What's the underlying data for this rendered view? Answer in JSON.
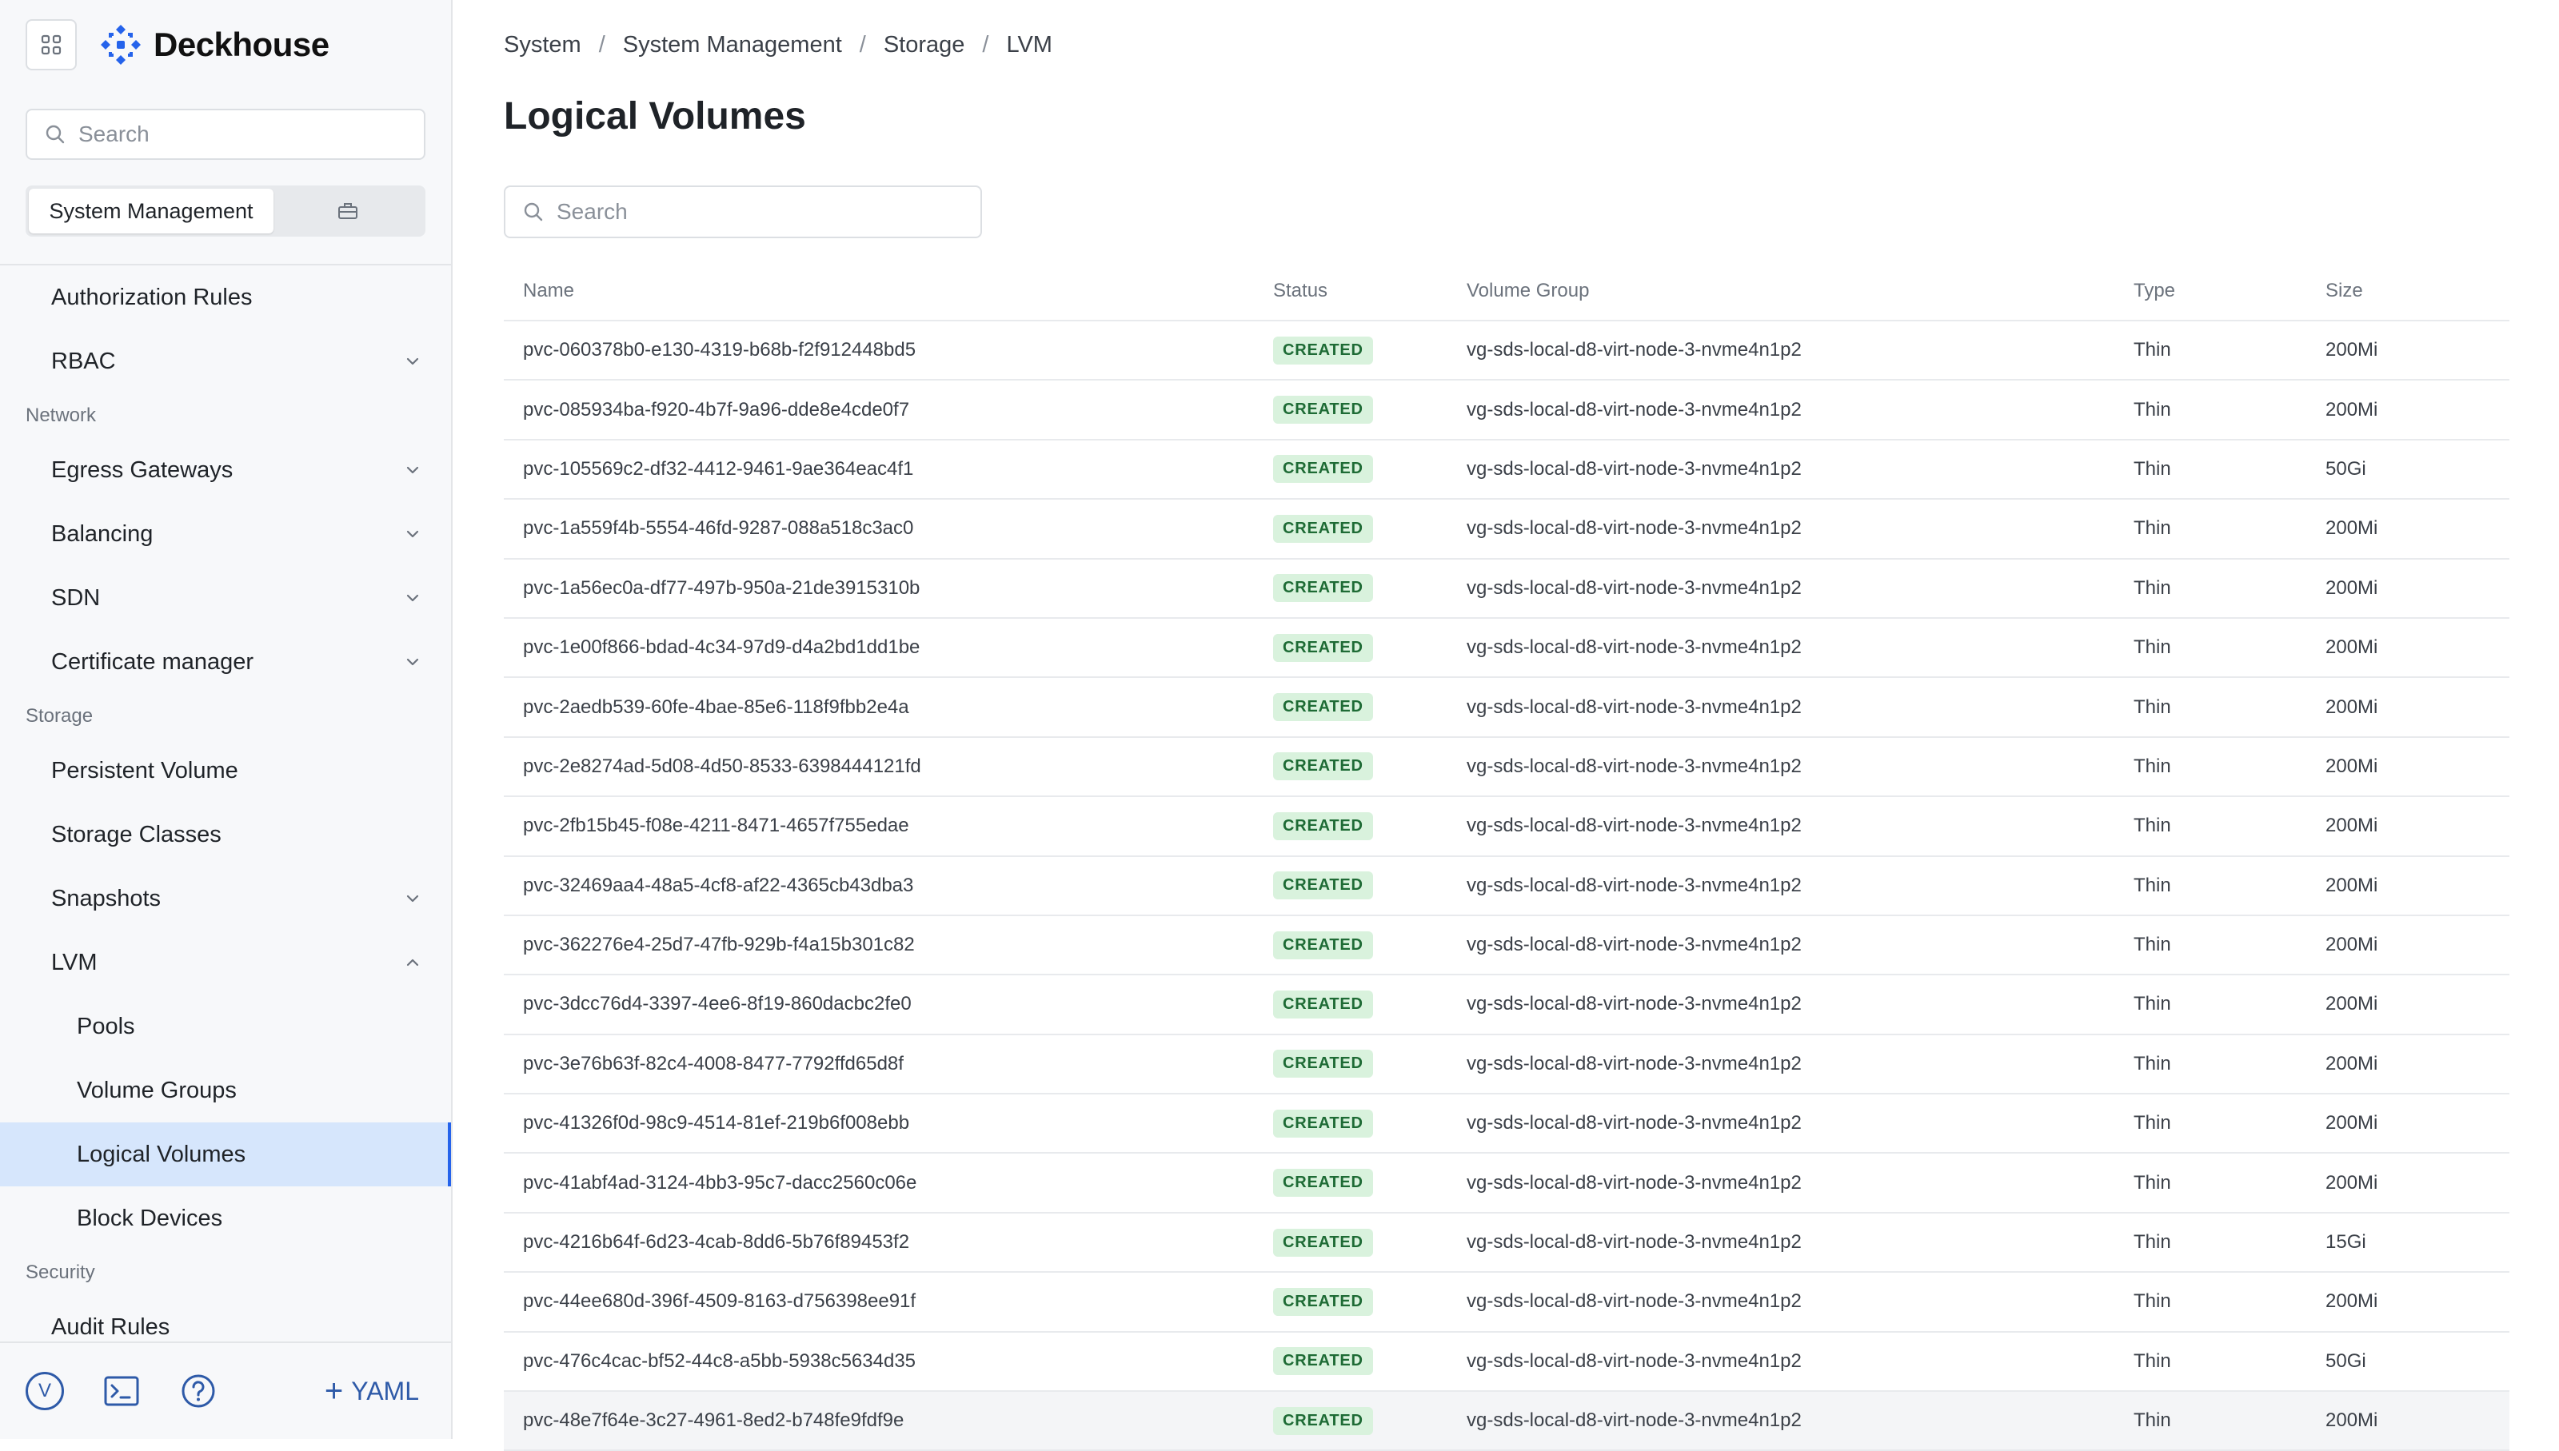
{
  "brand": {
    "name": "Deckhouse",
    "accent": "#2563eb",
    "logo_icon": "deckhouse-logo-icon"
  },
  "sidebar": {
    "search_placeholder": "Search",
    "scope_active": "System Management",
    "scope_alt_icon": "briefcase-icon",
    "nav": [
      {
        "type": "item",
        "label": "Authorization Rules",
        "chevron": ""
      },
      {
        "type": "item",
        "label": "RBAC",
        "chevron": "down"
      },
      {
        "type": "section",
        "label": "Network"
      },
      {
        "type": "item",
        "label": "Egress Gateways",
        "chevron": "down"
      },
      {
        "type": "item",
        "label": "Balancing",
        "chevron": "down"
      },
      {
        "type": "item",
        "label": "SDN",
        "chevron": "down"
      },
      {
        "type": "item",
        "label": "Certificate manager",
        "chevron": "down"
      },
      {
        "type": "section",
        "label": "Storage"
      },
      {
        "type": "item",
        "label": "Persistent Volume",
        "chevron": ""
      },
      {
        "type": "item",
        "label": "Storage Classes",
        "chevron": ""
      },
      {
        "type": "item",
        "label": "Snapshots",
        "chevron": "down"
      },
      {
        "type": "item",
        "label": "LVM",
        "chevron": "up"
      },
      {
        "type": "sub",
        "label": "Pools",
        "chevron": ""
      },
      {
        "type": "sub",
        "label": "Volume Groups",
        "chevron": ""
      },
      {
        "type": "sub",
        "label": "Logical Volumes",
        "chevron": "",
        "active": true
      },
      {
        "type": "sub",
        "label": "Block Devices",
        "chevron": ""
      },
      {
        "type": "section",
        "label": "Security"
      },
      {
        "type": "item",
        "label": "Audit Rules",
        "chevron": ""
      }
    ],
    "footer": {
      "avatar_letter": "V",
      "terminal_icon": "terminal-icon",
      "help_icon": "help-circle-icon",
      "yaml_label": "YAML"
    }
  },
  "main": {
    "breadcrumb": [
      "System",
      "System Management",
      "Storage",
      "LVM"
    ],
    "title": "Logical Volumes",
    "search_placeholder": "Search",
    "table": {
      "columns": [
        "Name",
        "Status",
        "Volume Group",
        "Type",
        "Size"
      ],
      "rows": [
        {
          "name": "pvc-060378b0-e130-4319-b68b-f2f912448bd5",
          "status": "CREATED",
          "vg": "vg-sds-local-d8-virt-node-3-nvme4n1p2",
          "type": "Thin",
          "size": "200Mi"
        },
        {
          "name": "pvc-085934ba-f920-4b7f-9a96-dde8e4cde0f7",
          "status": "CREATED",
          "vg": "vg-sds-local-d8-virt-node-3-nvme4n1p2",
          "type": "Thin",
          "size": "200Mi"
        },
        {
          "name": "pvc-105569c2-df32-4412-9461-9ae364eac4f1",
          "status": "CREATED",
          "vg": "vg-sds-local-d8-virt-node-3-nvme4n1p2",
          "type": "Thin",
          "size": "50Gi"
        },
        {
          "name": "pvc-1a559f4b-5554-46fd-9287-088a518c3ac0",
          "status": "CREATED",
          "vg": "vg-sds-local-d8-virt-node-3-nvme4n1p2",
          "type": "Thin",
          "size": "200Mi"
        },
        {
          "name": "pvc-1a56ec0a-df77-497b-950a-21de3915310b",
          "status": "CREATED",
          "vg": "vg-sds-local-d8-virt-node-3-nvme4n1p2",
          "type": "Thin",
          "size": "200Mi"
        },
        {
          "name": "pvc-1e00f866-bdad-4c34-97d9-d4a2bd1dd1be",
          "status": "CREATED",
          "vg": "vg-sds-local-d8-virt-node-3-nvme4n1p2",
          "type": "Thin",
          "size": "200Mi"
        },
        {
          "name": "pvc-2aedb539-60fe-4bae-85e6-118f9fbb2e4a",
          "status": "CREATED",
          "vg": "vg-sds-local-d8-virt-node-3-nvme4n1p2",
          "type": "Thin",
          "size": "200Mi"
        },
        {
          "name": "pvc-2e8274ad-5d08-4d50-8533-6398444121fd",
          "status": "CREATED",
          "vg": "vg-sds-local-d8-virt-node-3-nvme4n1p2",
          "type": "Thin",
          "size": "200Mi"
        },
        {
          "name": "pvc-2fb15b45-f08e-4211-8471-4657f755edae",
          "status": "CREATED",
          "vg": "vg-sds-local-d8-virt-node-3-nvme4n1p2",
          "type": "Thin",
          "size": "200Mi"
        },
        {
          "name": "pvc-32469aa4-48a5-4cf8-af22-4365cb43dba3",
          "status": "CREATED",
          "vg": "vg-sds-local-d8-virt-node-3-nvme4n1p2",
          "type": "Thin",
          "size": "200Mi"
        },
        {
          "name": "pvc-362276e4-25d7-47fb-929b-f4a15b301c82",
          "status": "CREATED",
          "vg": "vg-sds-local-d8-virt-node-3-nvme4n1p2",
          "type": "Thin",
          "size": "200Mi"
        },
        {
          "name": "pvc-3dcc76d4-3397-4ee6-8f19-860dacbc2fe0",
          "status": "CREATED",
          "vg": "vg-sds-local-d8-virt-node-3-nvme4n1p2",
          "type": "Thin",
          "size": "200Mi"
        },
        {
          "name": "pvc-3e76b63f-82c4-4008-8477-7792ffd65d8f",
          "status": "CREATED",
          "vg": "vg-sds-local-d8-virt-node-3-nvme4n1p2",
          "type": "Thin",
          "size": "200Mi"
        },
        {
          "name": "pvc-41326f0d-98c9-4514-81ef-219b6f008ebb",
          "status": "CREATED",
          "vg": "vg-sds-local-d8-virt-node-3-nvme4n1p2",
          "type": "Thin",
          "size": "200Mi"
        },
        {
          "name": "pvc-41abf4ad-3124-4bb3-95c7-dacc2560c06e",
          "status": "CREATED",
          "vg": "vg-sds-local-d8-virt-node-3-nvme4n1p2",
          "type": "Thin",
          "size": "200Mi"
        },
        {
          "name": "pvc-4216b64f-6d23-4cab-8dd6-5b76f89453f2",
          "status": "CREATED",
          "vg": "vg-sds-local-d8-virt-node-3-nvme4n1p2",
          "type": "Thin",
          "size": "15Gi"
        },
        {
          "name": "pvc-44ee680d-396f-4509-8163-d756398ee91f",
          "status": "CREATED",
          "vg": "vg-sds-local-d8-virt-node-3-nvme4n1p2",
          "type": "Thin",
          "size": "200Mi"
        },
        {
          "name": "pvc-476c4cac-bf52-44c8-a5bb-5938c5634d35",
          "status": "CREATED",
          "vg": "vg-sds-local-d8-virt-node-3-nvme4n1p2",
          "type": "Thin",
          "size": "50Gi"
        },
        {
          "name": "pvc-48e7f64e-3c27-4961-8ed2-b748fe9fdf9e",
          "status": "CREATED",
          "vg": "vg-sds-local-d8-virt-node-3-nvme4n1p2",
          "type": "Thin",
          "size": "200Mi"
        }
      ]
    }
  }
}
